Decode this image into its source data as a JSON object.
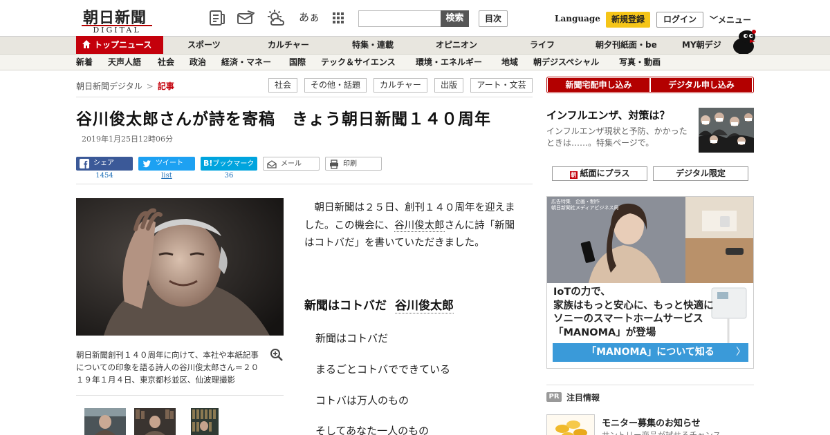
{
  "header": {
    "logo_text": "朝日新聞",
    "logo_sub": "DIGITAL",
    "font_size_glyph": "あぁ",
    "search_placeholder": "",
    "search_button": "検索",
    "toc_button": "目次",
    "language": "Language",
    "signup": "新規登録",
    "login": "ログイン",
    "menu": "メニュー",
    "icons": [
      "newspaper-icon",
      "paper-plane-icon",
      "weather-icon",
      "font-size-icon",
      "grid-icon"
    ]
  },
  "nav_primary": {
    "top_news": "トップニュース",
    "items": [
      "スポーツ",
      "カルチャー",
      "特集・連載",
      "オピニオン",
      "ライフ",
      "朝夕刊紙面・be",
      "MY朝デジ"
    ]
  },
  "nav_secondary": {
    "items": [
      "新着",
      "天声人語",
      "社会",
      "政治",
      "経済・マネー",
      "国際",
      "テック＆サイエンス",
      "環境・エネルギー",
      "地域",
      "朝デジスペシャル",
      "写真・動画"
    ]
  },
  "breadcrumb": {
    "home": "朝日新聞デジタル",
    "separator": ">",
    "current": "記事"
  },
  "tags": [
    "社会",
    "その他・話題",
    "カルチャー",
    "出版",
    "アート・文芸"
  ],
  "article": {
    "headline": "谷川俊太郎さんが詩を寄稿　きょう朝日新聞１４０周年",
    "date": "2019年1月25日12時06分",
    "share": {
      "facebook_label": "シェア",
      "facebook_count": "1454",
      "twitter_label": "ツイート",
      "twitter_count": "list",
      "hatena_label": "ブックマーク",
      "hatena_count": "36",
      "mail_label": "メール",
      "print_label": "印刷"
    },
    "photo_caption": "朝日新聞創刊１４０周年に向けて、本社や本紙記事についての印象を語る詩人の谷川俊太郎さん＝２０１９年１月４日、東京都杉並区、仙波理撮影",
    "body_before": "　朝日新聞は２５日、創刊１４０周年を迎えました。この機会に、",
    "body_author": "谷川俊太郎",
    "body_after": "さんに詩「新聞はコトバだ」を書いていただきました。",
    "poem_title": "新聞はコトバだ",
    "poem_author": "谷川俊太郎",
    "poem_lines": [
      "新聞はコトバだ",
      "まるごとコトバでできている",
      "コトバは万人のもの",
      "そしてあなた一人のもの"
    ]
  },
  "sidebar": {
    "subscribe_paper": "新聞宅配申し込み",
    "subscribe_digital": "デジタル申し込み",
    "promo_title": "インフルエンザ、対策は？",
    "promo_desc": "インフルエンザ現状と予防、かかったときは……。特集ページで。",
    "plus_button": "紙面にプラス",
    "digital_only_button": "デジタル限定",
    "ad": {
      "label_line1": "広告特集　企画・制作",
      "label_line2": "朝日新聞社メディアビジネス局",
      "copy_lines": [
        "IoTの力で、",
        "家族はもっと安心に、もっと快適に",
        "ソニーのスマートホームサービス",
        "「MANOMA」が登場"
      ],
      "cta": "「MANOMA」について知る",
      "cta_arrow": "〉"
    },
    "pr": {
      "badge": "PR",
      "title": "注目情報",
      "item_title": "モニター募集のお知らせ",
      "item_desc": "サントリー商品が試せるチャンス"
    }
  },
  "colors": {
    "brand_red": "#c4000b",
    "signup_yellow": "#f5c518",
    "facebook": "#3b5998",
    "twitter": "#1da1f2",
    "hatena": "#00a4de",
    "ad_cta_blue": "#3a9ad9"
  }
}
